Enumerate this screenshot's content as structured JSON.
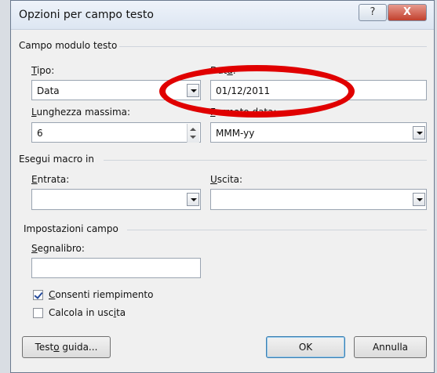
{
  "window": {
    "title": "Opzioni per campo testo",
    "help_label": "?",
    "close_label": "X"
  },
  "sections": {
    "text_form_field": {
      "title": "Campo modulo testo",
      "tipo": {
        "label_before": "",
        "label_u": "T",
        "label_after": "ipo:",
        "value": "Data"
      },
      "data": {
        "label_before": "Dat",
        "label_u": "a",
        "label_after": ":",
        "value": "01/12/2011"
      },
      "max_length": {
        "label_before": "",
        "label_u": "L",
        "label_after": "unghezza massima:",
        "value": "6"
      },
      "date_format": {
        "label_before": "",
        "label_u": "F",
        "label_after": "ormato data:",
        "value": "MMM-yy"
      }
    },
    "macro": {
      "title": "Esegui macro in",
      "entry": {
        "label_before": "",
        "label_u": "E",
        "label_after": "ntrata:",
        "value": ""
      },
      "exit": {
        "label_before": "",
        "label_u": "U",
        "label_after": "scita:",
        "value": ""
      }
    },
    "field_settings": {
      "title": "Impostazioni campo",
      "bookmark": {
        "label_before": "",
        "label_u": "S",
        "label_after": "egnalibro:",
        "value": ""
      },
      "fill_in": {
        "label_before": "",
        "label_u": "C",
        "label_after": "onsenti riempimento",
        "checked": true
      },
      "calc_exit": {
        "label_before": "Calcola in usc",
        "label_u": "i",
        "label_after": "ta",
        "checked": false
      }
    }
  },
  "buttons": {
    "help_text": {
      "label_before": "Test",
      "label_u": "o",
      "label_after": " guida..."
    },
    "ok": "OK",
    "cancel": "Annulla"
  },
  "colors": {
    "annotation": "#e00000",
    "accent": "#3c7fb1"
  }
}
